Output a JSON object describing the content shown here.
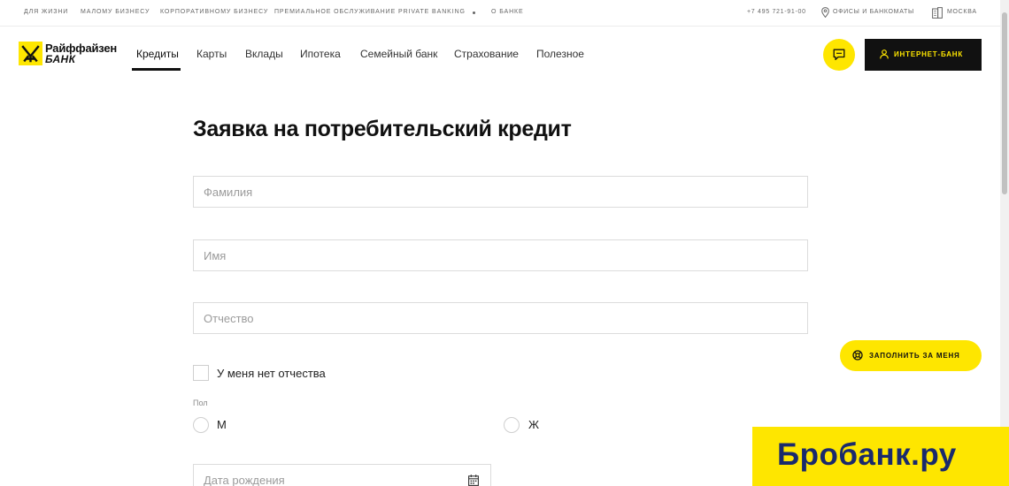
{
  "topbar": {
    "segments": [
      {
        "label": "Для жизни"
      },
      {
        "label": "Малому бизнесу"
      },
      {
        "label": "Корпоративному бизнесу"
      },
      {
        "label": "Премиальное обслуживание"
      },
      {
        "label": "Private Banking"
      },
      {
        "label": "О банке"
      }
    ],
    "phone": "+7 495 721-91-00",
    "offices_label": "ОФИСЫ И БАНКОМАТЫ",
    "city": "МОСКВА"
  },
  "logo": {
    "name": "Райффайзен",
    "bank": "БАНК"
  },
  "nav": {
    "items": [
      {
        "label": "Кредиты"
      },
      {
        "label": "Карты"
      },
      {
        "label": "Вклады"
      },
      {
        "label": "Ипотека"
      },
      {
        "label": "Семейный банк"
      },
      {
        "label": "Страхование"
      },
      {
        "label": "Полезное"
      }
    ],
    "internet_bank_label": "ИНТЕРНЕТ-БАНК"
  },
  "form": {
    "title": "Заявка на потребительский кредит",
    "surname_placeholder": "Фамилия",
    "name_placeholder": "Имя",
    "patronymic_placeholder": "Отчество",
    "no_patronymic_label": "У меня нет отчества",
    "gender_label": "Пол",
    "gender_male": "М",
    "gender_female": "Ж",
    "birthdate_placeholder": "Дата рождения"
  },
  "fill_for_me_label": "ЗАПОЛНИТЬ ЗА МЕНЯ",
  "watermark": "Бробанк.ру",
  "colors": {
    "accent": "#fee600",
    "dark": "#111111",
    "watermark_text": "#1a2a6c"
  }
}
